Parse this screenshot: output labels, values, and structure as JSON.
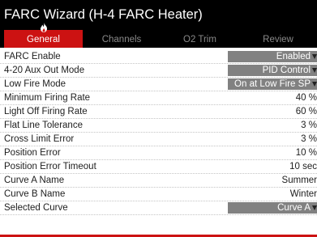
{
  "window": {
    "title": "FARC Wizard (H-4 FARC Heater)"
  },
  "tabs": [
    {
      "label": "General",
      "active": true
    },
    {
      "label": "Channels",
      "active": false
    },
    {
      "label": "O2 Trim",
      "active": false
    },
    {
      "label": "Review",
      "active": false
    }
  ],
  "rows": [
    {
      "label": "FARC Enable",
      "value": "Enabled",
      "type": "dropdown"
    },
    {
      "label": "4-20 Aux Out Mode",
      "value": "PID Control",
      "type": "dropdown"
    },
    {
      "label": "Low Fire Mode",
      "value": "On at Low Fire SP",
      "type": "dropdown"
    },
    {
      "label": "Minimum Firing Rate",
      "value": "40 %",
      "type": "text"
    },
    {
      "label": "Light Off Firing Rate",
      "value": "60 %",
      "type": "text"
    },
    {
      "label": "Flat Line Tolerance",
      "value": "3 %",
      "type": "text"
    },
    {
      "label": "Cross Limit Error",
      "value": "3 %",
      "type": "text"
    },
    {
      "label": "Position Error",
      "value": "10 %",
      "type": "text"
    },
    {
      "label": "Position Error Timeout",
      "value": "10 sec",
      "type": "text"
    },
    {
      "label": "Curve A Name",
      "value": "Summer",
      "type": "text"
    },
    {
      "label": "Curve B Name",
      "value": "Winter",
      "type": "text"
    },
    {
      "label": "Selected Curve",
      "value": "Curve A",
      "type": "dropdown"
    }
  ],
  "colors": {
    "accent": "#cc1212",
    "header_bg": "#000000",
    "dropdown_bg": "#818181"
  },
  "icons": {
    "active_tab": "flame-icon",
    "dropdown": "caret-down-icon"
  }
}
